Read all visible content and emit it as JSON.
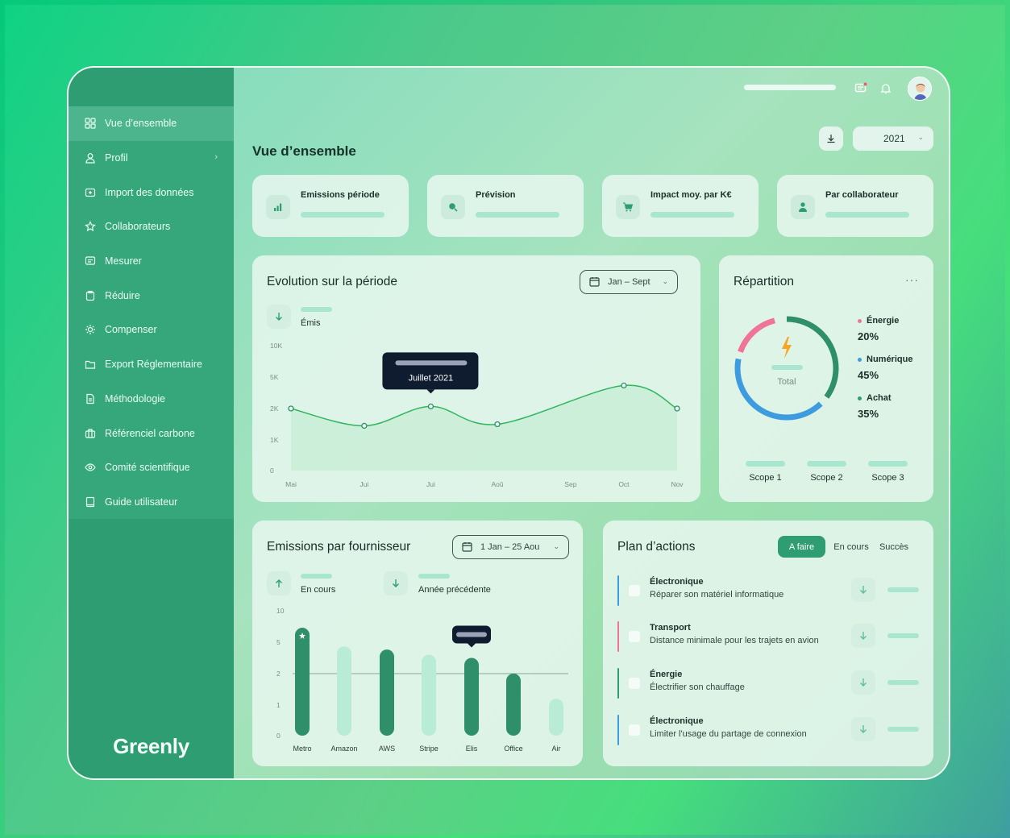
{
  "sidebar": {
    "items": [
      {
        "label": "Vue d’ensemble",
        "icon": "grid-icon",
        "active": true
      },
      {
        "label": "Profil",
        "icon": "user-icon",
        "has_chevron": true
      },
      {
        "label": "Import des données",
        "icon": "import-icon"
      },
      {
        "label": "Collaborateurs",
        "icon": "star-icon"
      },
      {
        "label": "Mesurer",
        "icon": "message-icon"
      },
      {
        "label": "Réduire",
        "icon": "clipboard-icon"
      },
      {
        "label": "Compenser",
        "icon": "sun-icon"
      },
      {
        "label": "Export Réglementaire",
        "icon": "folder-icon"
      },
      {
        "label": "Méthodologie",
        "icon": "document-icon"
      },
      {
        "label": "Référenciel carbone",
        "icon": "briefcase-icon"
      },
      {
        "label": "Comité scientifique",
        "icon": "eye-icon"
      },
      {
        "label": "Guide utilisateur",
        "icon": "book-icon"
      }
    ],
    "logo": "Greenly"
  },
  "header": {
    "page_title": "Vue d’ensemble",
    "year": "2021"
  },
  "kpis": [
    {
      "label": "Emissions période",
      "icon": "bar-chart-icon"
    },
    {
      "label": "Prévision",
      "icon": "search-icon"
    },
    {
      "label": "Impact moy. par K€",
      "icon": "cart-icon"
    },
    {
      "label": "Par collaborateur",
      "icon": "person-icon"
    }
  ],
  "evolution": {
    "title": "Evolution sur la période",
    "range": "Jan – Sept",
    "metric_label": "Émis",
    "tooltip": "Juillet 2021"
  },
  "repartition": {
    "title": "Répartition",
    "center_label": "Total",
    "legend": [
      {
        "name": "Énergie",
        "value": "20%",
        "color": "#f0739a"
      },
      {
        "name": "Numérique",
        "value": "45%",
        "color": "#3d9be0"
      },
      {
        "name": "Achat",
        "value": "35%",
        "color": "#2f9d72"
      }
    ],
    "scopes": [
      "Scope 1",
      "Scope 2",
      "Scope 3"
    ]
  },
  "suppliers": {
    "title": "Emissions par fournisseur",
    "range": "1 Jan – 25 Aou",
    "current_label": "En cours",
    "previous_label": "Année précédente"
  },
  "plan": {
    "title": "Plan d’actions",
    "tabs": [
      "A faire",
      "En cours",
      "Succès"
    ],
    "actions": [
      {
        "category": "Électronique",
        "description": "Réparer son matériel informatique",
        "color": "#3d9be0"
      },
      {
        "category": "Transport",
        "description": "Distance minimale pour les trajets en avion",
        "color": "#f0739a"
      },
      {
        "category": "Énergie",
        "description": "Électrifier son chauffage",
        "color": "#2f9d72"
      },
      {
        "category": "Électronique",
        "description": "Limiter l'usage du partage de connexion",
        "color": "#3d9be0"
      }
    ]
  },
  "colors": {
    "accent": "#2f9d72",
    "light_accent": "#a8e6cf",
    "tooltip_bg": "#0f1b2e"
  },
  "chart_data": [
    {
      "type": "line",
      "x": [
        "Mai",
        "Jui",
        "Jui",
        "Aoû",
        "Sep",
        "Oct",
        "Nov"
      ],
      "yticks": [
        "10K",
        "5K",
        "2K",
        "1K",
        "0"
      ],
      "series": [
        {
          "values": [
            2,
            1.45,
            2.2,
            1.5,
            null,
            4.2,
            2
          ]
        }
      ],
      "point_x_positions": [
        0,
        1.1,
        2.1,
        3.1,
        4.2,
        5,
        5.8
      ],
      "highlight": "Jui"
    },
    {
      "type": "bar",
      "categories": [
        "Metro",
        "Amazon",
        "AWS",
        "Stripe",
        "Elis",
        "Office",
        "Air"
      ],
      "yticks": [
        "10",
        "5",
        "2",
        "1",
        "0"
      ],
      "series": [
        {
          "name": "En cours",
          "values": [
            7.3,
            null,
            4.3,
            null,
            3.5,
            2.0,
            null
          ]
        },
        {
          "name": "Année précédente",
          "values": [
            null,
            4.6,
            null,
            3.8,
            null,
            null,
            1.2
          ]
        }
      ],
      "reference_line": 2
    }
  ]
}
